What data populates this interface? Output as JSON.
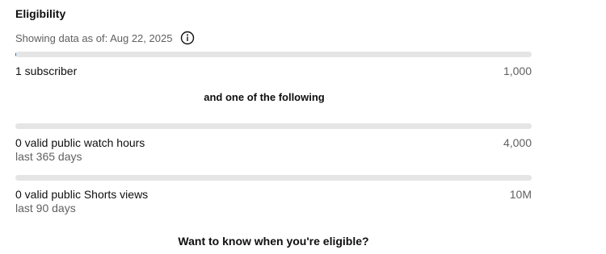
{
  "header": {
    "title": "Eligibility",
    "as_of": "Showing data as of: Aug 22, 2025",
    "info_icon": "info-icon"
  },
  "requirements": [
    {
      "label": "1 subscriber",
      "sublabel": "",
      "target": "1,000",
      "progress_fraction": 0.001
    },
    {
      "label": "0 valid public watch hours",
      "sublabel": "last 365 days",
      "target": "4,000",
      "progress_fraction": 0
    },
    {
      "label": "0 valid public Shorts views",
      "sublabel": "last 90 days",
      "target": "10M",
      "progress_fraction": 0
    }
  ],
  "separator": "and one of the following",
  "cta": "Want to know when you're eligible?",
  "colors": {
    "track": "#e5e5e5",
    "fill": "#065fd4",
    "primary_text": "#0f0f0f",
    "secondary_text": "#606060"
  }
}
